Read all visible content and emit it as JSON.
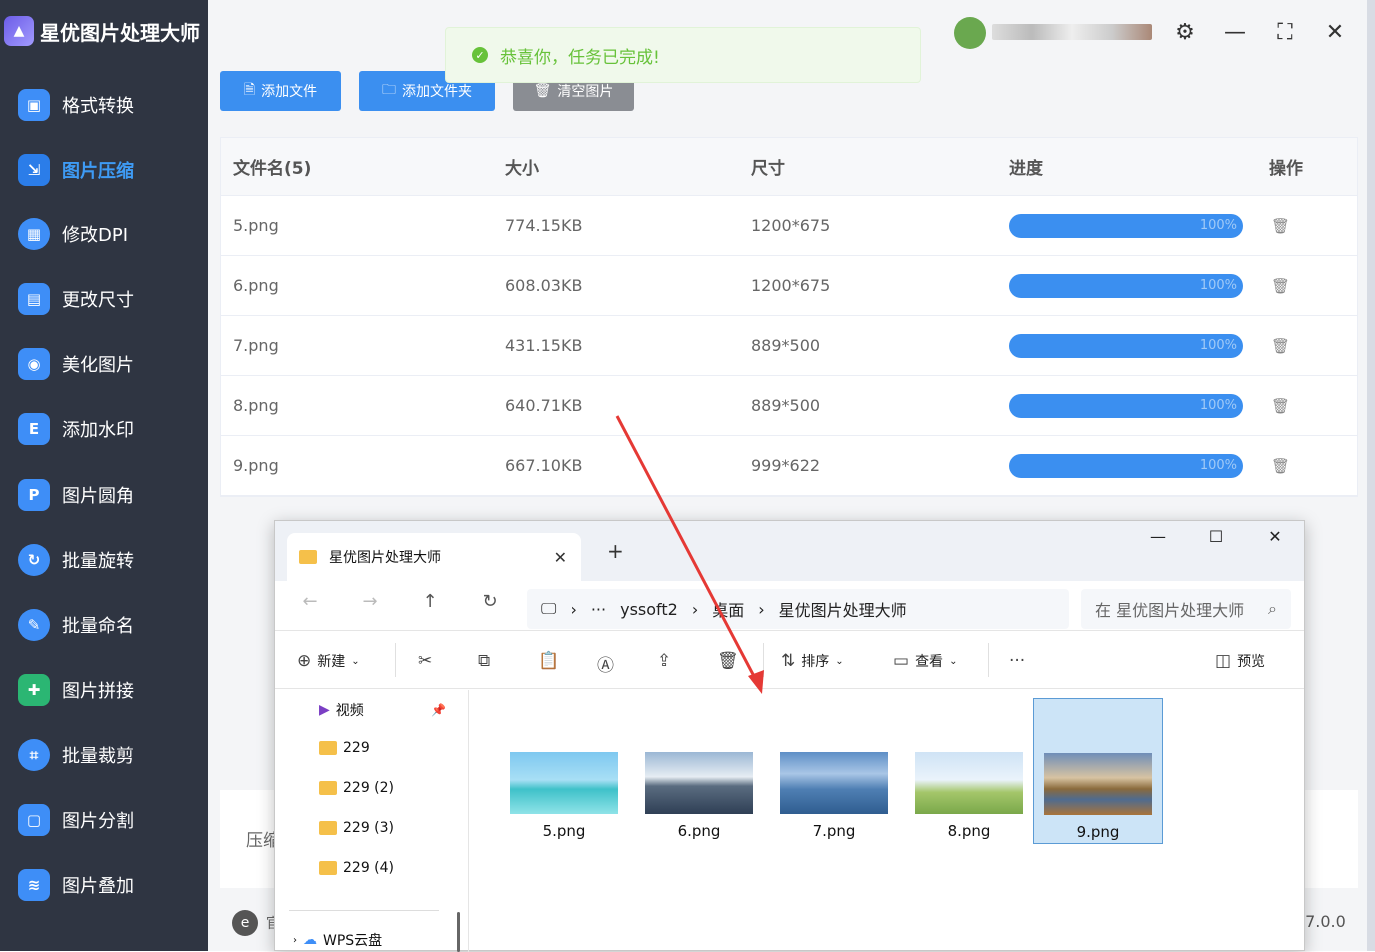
{
  "app": {
    "title": "星优图片处理大师"
  },
  "sidebar": {
    "items": [
      {
        "label": "格式转换",
        "icon": "image-convert-icon",
        "active": false
      },
      {
        "label": "图片压缩",
        "icon": "image-compress-icon",
        "active": true
      },
      {
        "label": "修改DPI",
        "icon": "dpi-icon",
        "active": false
      },
      {
        "label": "更改尺寸",
        "icon": "resize-icon",
        "active": false
      },
      {
        "label": "美化图片",
        "icon": "beautify-icon",
        "active": false
      },
      {
        "label": "添加水印",
        "icon": "watermark-icon",
        "active": false
      },
      {
        "label": "图片圆角",
        "icon": "round-corner-icon",
        "active": false
      },
      {
        "label": "批量旋转",
        "icon": "rotate-icon",
        "active": false
      },
      {
        "label": "批量命名",
        "icon": "rename-icon",
        "active": false
      },
      {
        "label": "图片拼接",
        "icon": "stitch-icon",
        "active": false
      },
      {
        "label": "批量裁剪",
        "icon": "crop-icon",
        "active": false
      },
      {
        "label": "图片分割",
        "icon": "split-icon",
        "active": false
      },
      {
        "label": "图片叠加",
        "icon": "overlay-icon",
        "active": false
      }
    ]
  },
  "toolbar": {
    "add_file": "添加文件",
    "add_folder": "添加文件夹",
    "clear_images": "清空图片"
  },
  "toast": {
    "message": "恭喜你，任务已完成!"
  },
  "table": {
    "headers": [
      "文件名(5)",
      "大小",
      "尺寸",
      "进度",
      "操作"
    ],
    "rows": [
      {
        "name": "5.png",
        "size": "774.15KB",
        "dims": "1200*675",
        "progress": "100%"
      },
      {
        "name": "6.png",
        "size": "608.03KB",
        "dims": "1200*675",
        "progress": "100%"
      },
      {
        "name": "7.png",
        "size": "431.15KB",
        "dims": "889*500",
        "progress": "100%"
      },
      {
        "name": "8.png",
        "size": "640.71KB",
        "dims": "889*500",
        "progress": "100%"
      },
      {
        "name": "9.png",
        "size": "667.10KB",
        "dims": "999*622",
        "progress": "100%"
      }
    ]
  },
  "bottom": {
    "label_partial": "压缩"
  },
  "status": {
    "partial": "官",
    "version": ".7.0.0"
  },
  "explorer": {
    "tab_title": "星优图片处理大师",
    "breadcrumb": [
      "yssoft2",
      "桌面",
      "星优图片处理大师"
    ],
    "search_placeholder": "在 星优图片处理大师",
    "toolbar": {
      "new": "新建",
      "sort": "排序",
      "view": "查看",
      "preview": "预览"
    },
    "tree": [
      {
        "label": "视频",
        "pinned": true
      },
      {
        "label": "229"
      },
      {
        "label": "229 (2)"
      },
      {
        "label": "229 (3)"
      },
      {
        "label": "229 (4)"
      },
      {
        "label": "WPS云盘"
      }
    ],
    "files": [
      {
        "name": "5.png",
        "selected": false,
        "colors": [
          "#7ec8f0",
          "#3fc1c9"
        ]
      },
      {
        "name": "6.png",
        "selected": false,
        "colors": [
          "#9bb7d4",
          "#2f3f55"
        ]
      },
      {
        "name": "7.png",
        "selected": false,
        "colors": [
          "#5e8fc6",
          "#2f5d90"
        ]
      },
      {
        "name": "8.png",
        "selected": false,
        "colors": [
          "#cfe3f5",
          "#7aa84a"
        ]
      },
      {
        "name": "9.png",
        "selected": true,
        "colors": [
          "#6f8eb8",
          "#a8743b"
        ]
      }
    ]
  }
}
